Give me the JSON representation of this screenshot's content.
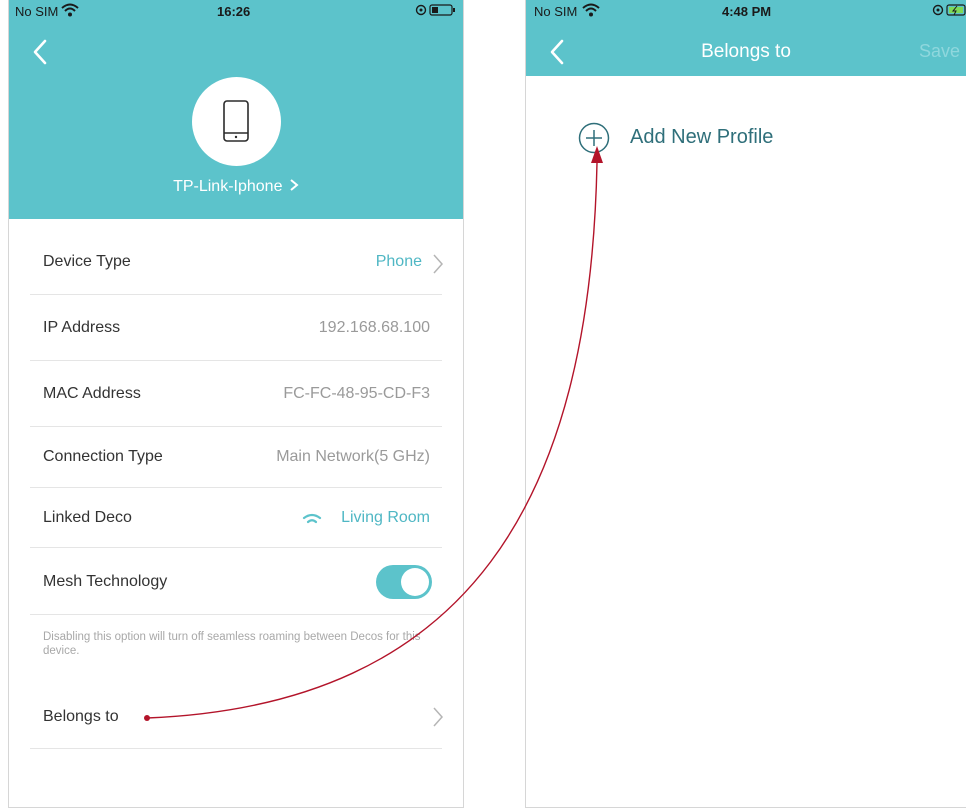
{
  "left_screen": {
    "status": {
      "carrier": "No SIM",
      "time": "16:26"
    },
    "device": {
      "name": "TP-Link-Iphone",
      "icon": "phone-icon"
    },
    "rows": {
      "device_type": {
        "label": "Device Type",
        "value": "Phone"
      },
      "ip_address": {
        "label": "IP Address",
        "value": "192.168.68.100"
      },
      "mac_address": {
        "label": "MAC Address",
        "value": "FC-FC-48-95-CD-F3"
      },
      "connection_type": {
        "label": "Connection Type",
        "value": "Main Network(5 GHz)"
      },
      "linked_deco": {
        "label": "Linked Deco",
        "value": "Living Room"
      },
      "mesh_technology": {
        "label": "Mesh Technology",
        "enabled": true
      },
      "belongs_to": {
        "label": "Belongs to"
      }
    },
    "mesh_helper_text": "Disabling this option will turn off seamless roaming between Decos for this device."
  },
  "right_screen": {
    "status": {
      "carrier": "No SIM",
      "time": "4:48 PM"
    },
    "title": "Belongs to",
    "save_label": "Save",
    "add_profile_label": "Add New Profile"
  },
  "colors": {
    "teal": "#5cc3cb",
    "accent_text": "#4fb7c4",
    "annotation_arrow": "#b3142a"
  }
}
